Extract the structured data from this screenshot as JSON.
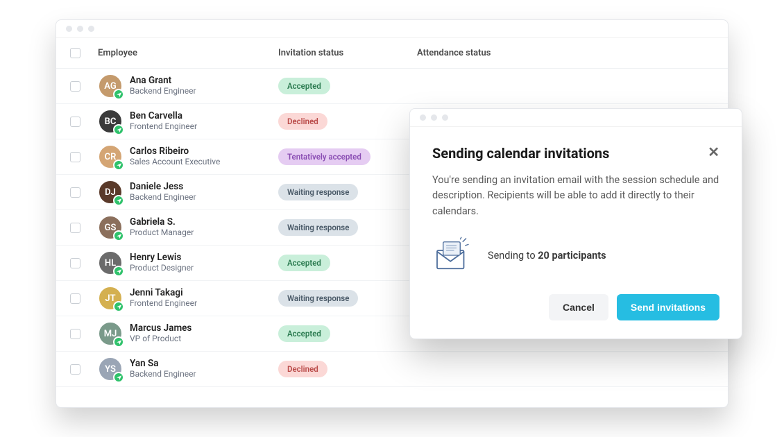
{
  "headers": {
    "employee": "Employee",
    "invitation": "Invitation status",
    "attendance": "Attendance status"
  },
  "statusLabels": {
    "accepted": "Accepted",
    "declined": "Declined",
    "tentative": "Tentatively accepted",
    "waiting": "Waiting response"
  },
  "employees": [
    {
      "name": "Ana Grant",
      "role": "Backend Engineer",
      "status": "accepted",
      "color": "#c49a6c"
    },
    {
      "name": "Ben Carvella",
      "role": "Frontend Engineer",
      "status": "declined",
      "color": "#3a3a3a"
    },
    {
      "name": "Carlos Ribeiro",
      "role": "Sales Account Executive",
      "status": "tentative",
      "color": "#d4a574"
    },
    {
      "name": "Daniele Jess",
      "role": "Backend Engineer",
      "status": "waiting",
      "color": "#5a3a2a"
    },
    {
      "name": "Gabriela S.",
      "role": "Product Manager",
      "status": "waiting",
      "color": "#8b6f5c"
    },
    {
      "name": "Henry Lewis",
      "role": "Product Designer",
      "status": "accepted",
      "color": "#6b6b6b"
    },
    {
      "name": "Jenni Takagi",
      "role": "Frontend Engineer",
      "status": "waiting",
      "color": "#d4b050"
    },
    {
      "name": "Marcus James",
      "role": "VP of Product",
      "status": "accepted",
      "color": "#7a9a8a"
    },
    {
      "name": "Yan Sa",
      "role": "Backend Engineer",
      "status": "declined",
      "color": "#9aa5b5"
    }
  ],
  "modal": {
    "title": "Sending calendar invitations",
    "description": "You're sending an invitation email with the session schedule and description. Recipients will be able to add it directly to their calendars.",
    "sending_prefix": "Sending to ",
    "sending_count": "20 participants",
    "cancel": "Cancel",
    "confirm": "Send invitations"
  }
}
